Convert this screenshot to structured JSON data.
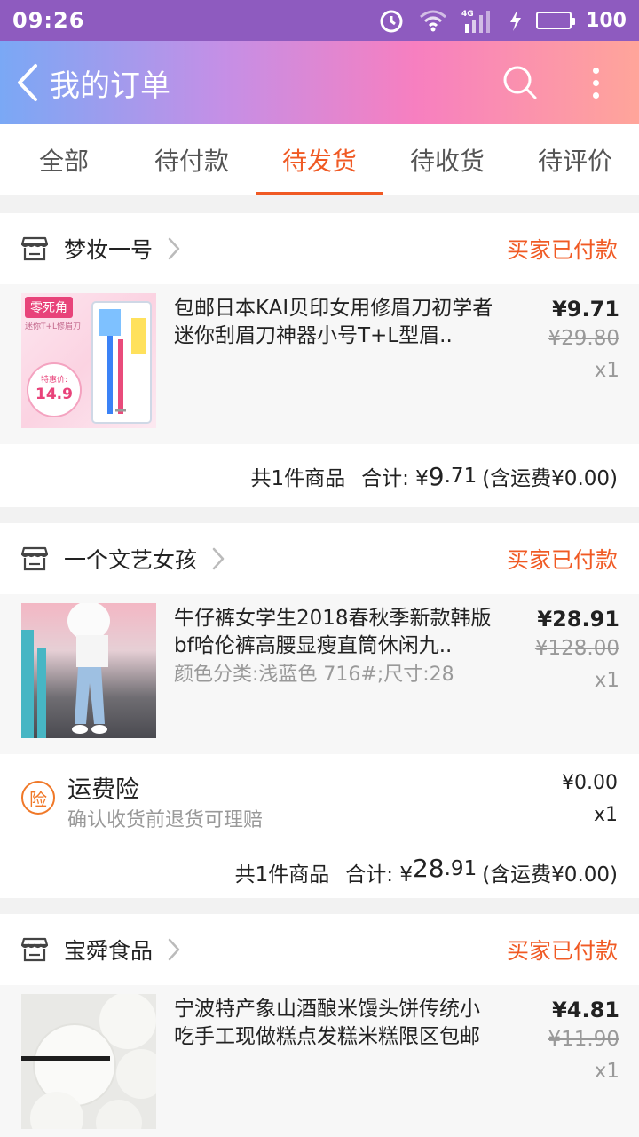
{
  "status_bar": {
    "time": "09:26",
    "network": "4G",
    "battery": "100"
  },
  "header": {
    "title": "我的订单"
  },
  "tabs": [
    {
      "label": "全部",
      "active": false
    },
    {
      "label": "待付款",
      "active": false
    },
    {
      "label": "待发货",
      "active": true
    },
    {
      "label": "待收货",
      "active": false
    },
    {
      "label": "待评价",
      "active": false
    }
  ],
  "orders": [
    {
      "shop": "梦妆一号",
      "status": "买家已付款",
      "item": {
        "title": "包邮日本KAI贝印女用修眉刀初学者迷你刮眉刀神器小号T+L型眉..",
        "variant": "",
        "price": "¥9.71",
        "original_price": "¥29.80",
        "qty": "x1",
        "thumb_text": {
          "brand": "零死角",
          "sub": "迷你T+L修眉刀",
          "deal": "特惠价:",
          "deal_price": "14.9"
        }
      },
      "summary": {
        "count": "共1件商品",
        "total_label": "合计: ¥",
        "total_int": "9",
        "total_dec": ".71",
        "shipping": "(含运费¥0.00)"
      }
    },
    {
      "shop": "一个文艺女孩",
      "status": "买家已付款",
      "item": {
        "title": "牛仔裤女学生2018春秋季新款韩版bf哈伦裤高腰显瘦直筒休闲九..",
        "variant": "颜色分类:浅蓝色 716#;尺寸:28",
        "price": "¥28.91",
        "original_price": "¥128.00",
        "qty": "x1"
      },
      "insurance": {
        "badge": "险",
        "title": "运费险",
        "desc": "确认收货前退货可理赔",
        "price": "¥0.00",
        "qty": "x1"
      },
      "summary": {
        "count": "共1件商品",
        "total_label": "合计: ¥",
        "total_int": "28",
        "total_dec": ".91",
        "shipping": "(含运费¥0.00)"
      }
    },
    {
      "shop": "宝舜食品",
      "status": "买家已付款",
      "item": {
        "title": "宁波特产象山酒酿米馒头饼传统小吃手工现做糕点发糕米糕限区包邮",
        "variant": "",
        "price": "¥4.81",
        "original_price": "¥11.90",
        "qty": "x1"
      }
    }
  ],
  "colors": {
    "accent": "#f05a24",
    "status_bar": "#8e5bbf"
  }
}
